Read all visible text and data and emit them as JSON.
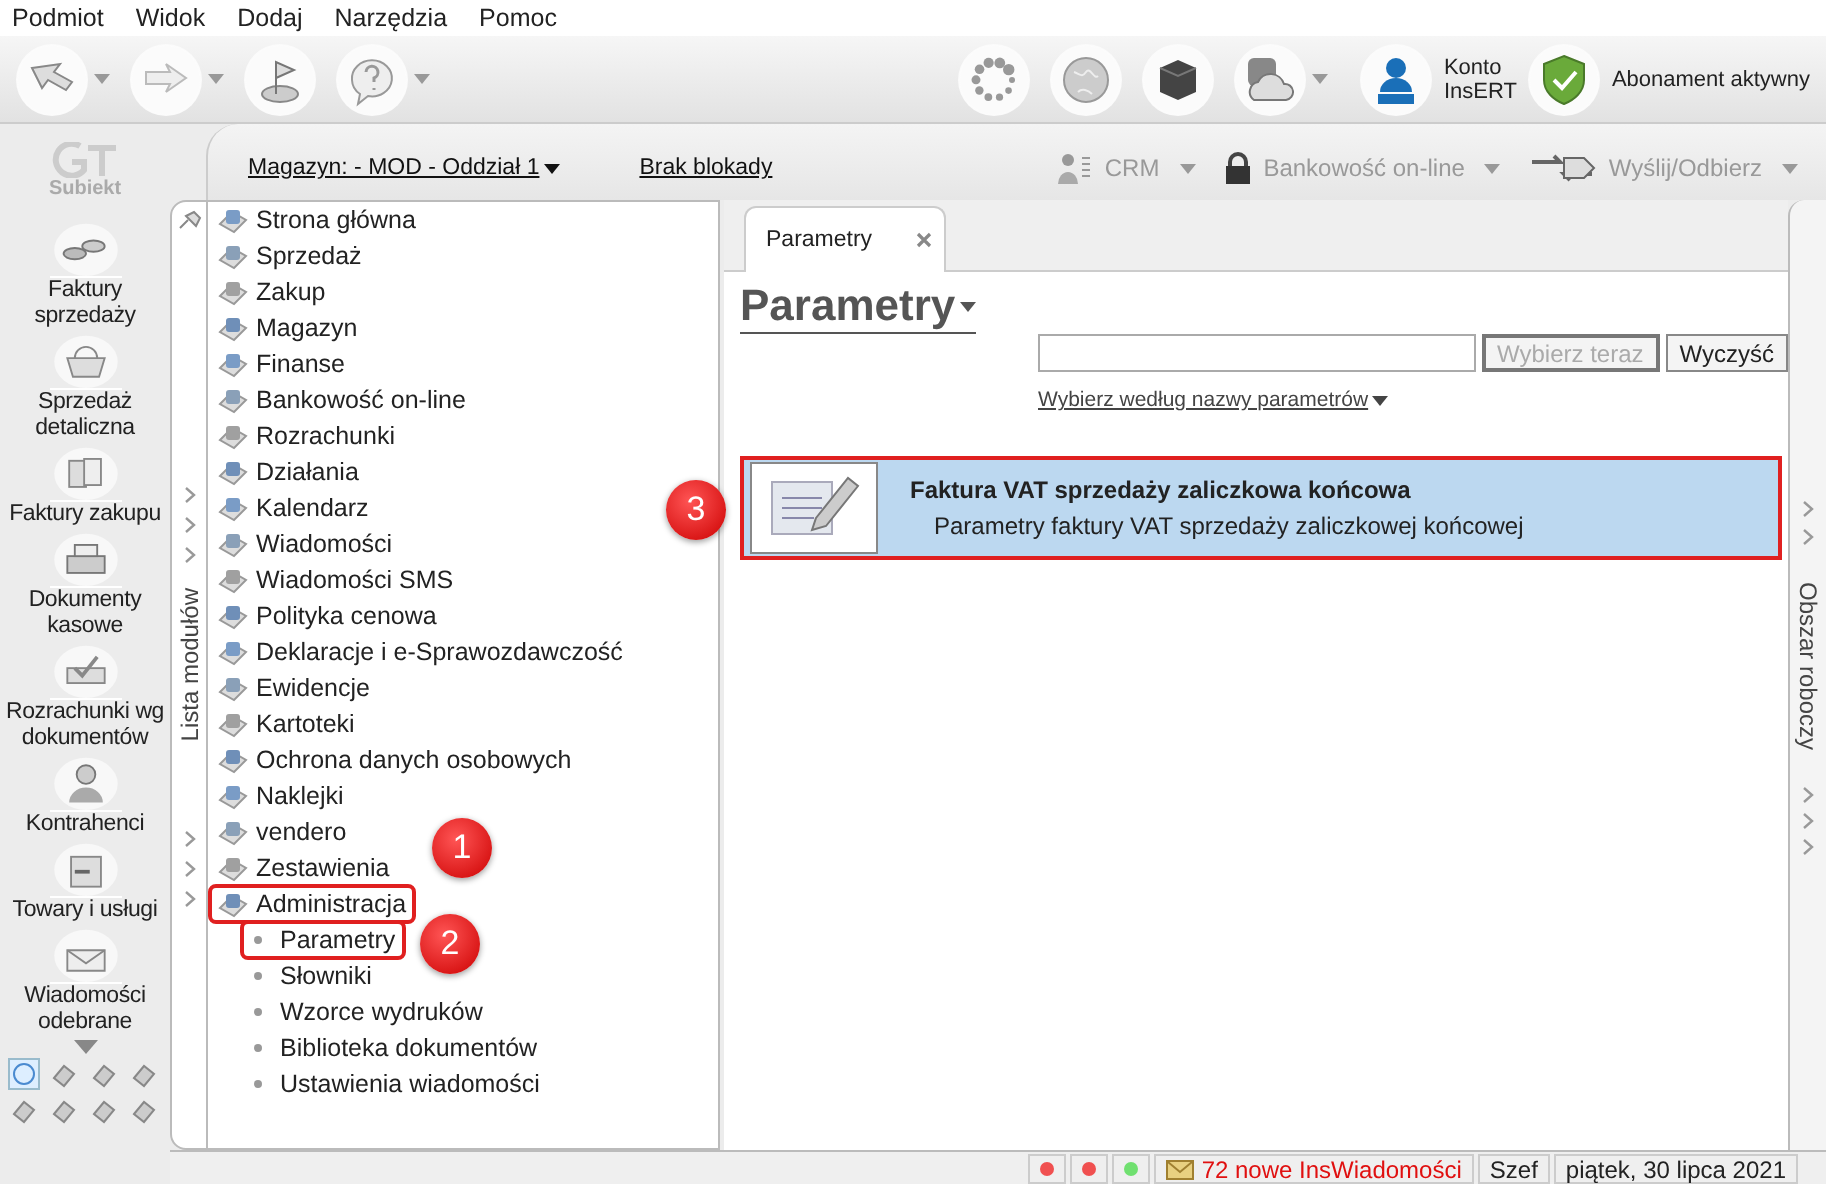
{
  "menu": [
    "Podmiot",
    "Widok",
    "Dodaj",
    "Narzędzia",
    "Pomoc"
  ],
  "toolbar": {
    "left_tools": [
      {
        "dropdown": true
      },
      {
        "dropdown": true
      },
      {
        "dropdown": false
      },
      {
        "dropdown": true
      }
    ],
    "right_tools": [
      {
        "dropdown": false
      },
      {
        "dropdown": false
      },
      {
        "dropdown": false
      },
      {
        "dropdown": true
      }
    ],
    "account": {
      "label": "Konto InsERT"
    },
    "subscription": {
      "label": "Abonament aktywny"
    }
  },
  "logo": {
    "label": "Subiekt"
  },
  "sidebar": {
    "items": [
      "Faktury sprzedaży",
      "Sprzedaż detaliczna",
      "Faktury zakupu",
      "Dokumenty kasowe",
      "Rozrachunki wg dokumentów",
      "Kontrahenci",
      "Towary i usługi",
      "Wiadomości odebrane"
    ],
    "shortcuts": [
      {
        "selected": true
      },
      {
        "selected": false
      },
      {
        "selected": false
      },
      {
        "selected": false
      },
      {
        "selected": false
      },
      {
        "selected": false
      },
      {
        "selected": false
      },
      {
        "selected": false
      }
    ]
  },
  "topbar": {
    "warehouse": "Magazyn: - MOD - Oddział 1",
    "lock": "Brak blokady",
    "actions": [
      {
        "label": "CRM",
        "disabled": true
      },
      {
        "label": "Bankowość on-line",
        "disabled": true
      },
      {
        "label": "Wyślij/Odbierz",
        "disabled": true
      }
    ]
  },
  "modules": {
    "strip_label": "Lista modułów",
    "items": [
      {
        "label": "Strona główna"
      },
      {
        "label": "Sprzedaż"
      },
      {
        "label": "Zakup"
      },
      {
        "label": "Magazyn"
      },
      {
        "label": "Finanse"
      },
      {
        "label": "Bankowość on-line"
      },
      {
        "label": "Rozrachunki"
      },
      {
        "label": "Działania"
      },
      {
        "label": "Kalendarz"
      },
      {
        "label": "Wiadomości"
      },
      {
        "label": "Wiadomości SMS"
      },
      {
        "label": "Polityka cenowa"
      },
      {
        "label": "Deklaracje i e-Sprawozdawczość"
      },
      {
        "label": "Ewidencje"
      },
      {
        "label": "Kartoteki"
      },
      {
        "label": "Ochrona danych osobowych"
      },
      {
        "label": "Naklejki"
      },
      {
        "label": "vendero"
      },
      {
        "label": "Zestawienia"
      },
      {
        "label": "Administracja",
        "callout": "1",
        "children": [
          {
            "label": "Parametry",
            "callout": "2"
          },
          {
            "label": "Słowniki"
          },
          {
            "label": "Wzorce wydruków"
          },
          {
            "label": "Biblioteka dokumentów"
          },
          {
            "label": "Ustawienia wiadomości"
          }
        ]
      }
    ]
  },
  "tabs": [
    {
      "label": "Parametry",
      "selected": true
    }
  ],
  "content": {
    "heading": "Parametry",
    "search": {
      "buttons": [
        {
          "label": "Wybierz teraz",
          "disabled": true
        },
        {
          "label": "Wyczyść",
          "disabled": false
        }
      ]
    },
    "filter_link": "Wybierz według nazwy parametrów",
    "results": [
      {
        "title": "Faktura VAT sprzedaży zaliczkowa końcowa",
        "description": "Parametry faktury VAT sprzedaży zaliczkowej końcowej",
        "selected": true,
        "callout": "3"
      }
    ]
  },
  "workspace_strip": {
    "label": "Obszar roboczy"
  },
  "status_bar": {
    "lights": [
      {
        "color": "#f05050"
      },
      {
        "color": "#f05050"
      },
      {
        "color": "#70e070"
      }
    ],
    "messages": "72 nowe InsWiadomości",
    "user": "Szef",
    "date": "piątek, 30 lipca 2021"
  }
}
